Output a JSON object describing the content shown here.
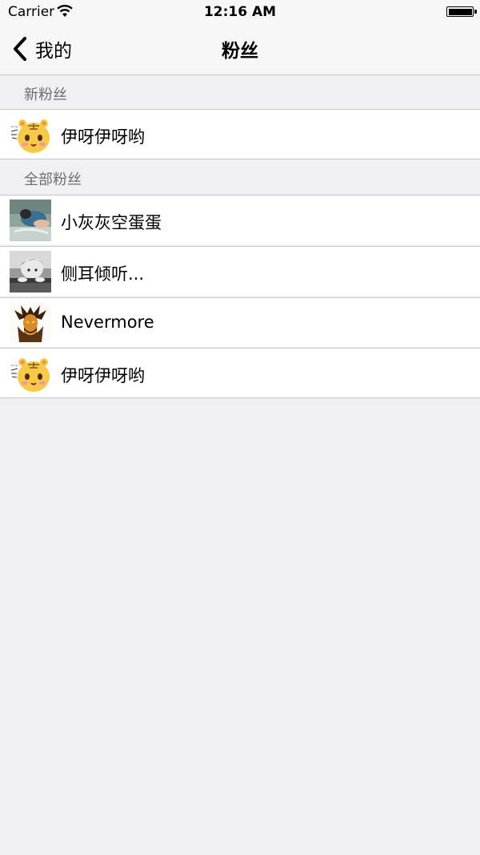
{
  "status_bar": {
    "carrier": "Carrier",
    "time": "12:16 AM"
  },
  "nav": {
    "back_label": "我的",
    "title": "粉丝"
  },
  "sections": [
    {
      "header": "新粉丝",
      "rows": [
        {
          "name": "伊呀伊呀哟",
          "avatar": "hamster-avatar"
        }
      ]
    },
    {
      "header": "全部粉丝",
      "rows": [
        {
          "name": "小灰灰空蛋蛋",
          "avatar": "child-photo-avatar"
        },
        {
          "name": "侧耳倾听...",
          "avatar": "bw-child-photo-avatar"
        },
        {
          "name": "Nevermore",
          "avatar": "demon-avatar"
        },
        {
          "name": "伊呀伊呀哟",
          "avatar": "hamster-avatar"
        }
      ]
    }
  ],
  "colors": {
    "background": "#efeff4",
    "bar": "#f7f7f7",
    "separator": "#c8c7cc",
    "header_text": "#6d6d72"
  }
}
